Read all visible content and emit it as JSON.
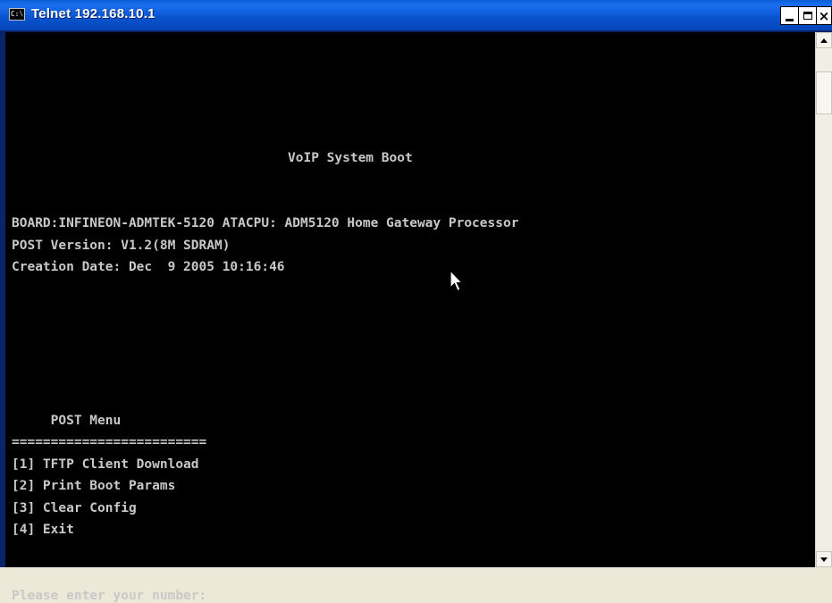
{
  "window": {
    "title": "Telnet 192.168.10.1",
    "icon_text": "C:\\",
    "min_label": "",
    "max_label": "",
    "close_label": "×"
  },
  "terminal": {
    "lines": [
      {
        "text": "VoIP System Boot",
        "row": 5,
        "col": 0
      },
      {
        "text": "BOARD:INFINEON-ADMTEK-5120 ATACPU: ADM5120 Home Gateway Processor",
        "row": 8,
        "col": 0
      },
      {
        "text": "POST Version: V1.2(8M SDRAM)",
        "row": 9,
        "col": 0
      },
      {
        "text": "Creation Date: Dec  9 2005 10:16:46",
        "row": 10,
        "col": 0
      },
      {
        "text": "     POST Menu",
        "row": 17,
        "col": 0
      },
      {
        "text": "=========================",
        "row": 18,
        "col": 0
      },
      {
        "text": "[1] TFTP Client Download",
        "row": 19,
        "col": 0
      },
      {
        "text": "[2] Print Boot Params",
        "row": 20,
        "col": 0
      },
      {
        "text": "[3] Clear Config",
        "row": 21,
        "col": 0
      },
      {
        "text": "[4] Exit",
        "row": 22,
        "col": 0
      },
      {
        "text": "Please enter your number:",
        "row": 25,
        "col": 0
      }
    ]
  },
  "colors": {
    "terminal_bg": "#000000",
    "terminal_fg": "#c8c8c8",
    "titlebar": "#0a55d0"
  }
}
